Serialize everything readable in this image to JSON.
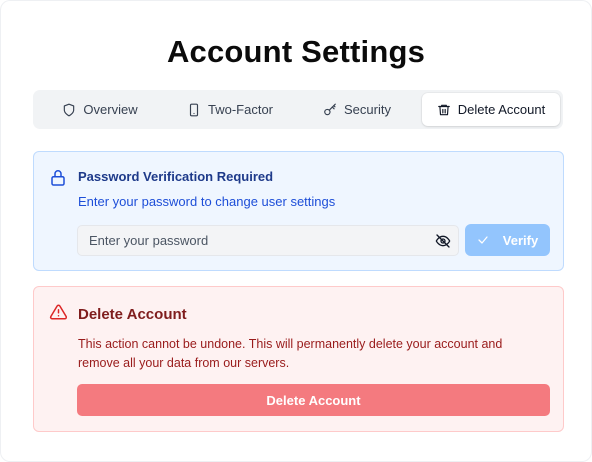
{
  "page": {
    "title": "Account Settings"
  },
  "tabs": [
    {
      "label": "Overview",
      "icon": "shield-icon",
      "active": false
    },
    {
      "label": "Two-Factor",
      "icon": "smartphone-icon",
      "active": false
    },
    {
      "label": "Security",
      "icon": "key-icon",
      "active": false
    },
    {
      "label": "Delete Account",
      "icon": "trash-icon",
      "active": true
    }
  ],
  "verification": {
    "title": "Password Verification Required",
    "description": "Enter your password to change user settings",
    "password_value": "",
    "password_placeholder": "Enter your password",
    "verify_label": "Verify",
    "icon": "lock-icon",
    "accent": "#1d4ed8"
  },
  "danger": {
    "title": "Delete Account",
    "description": "This action cannot be undone. This will permanently delete your account and remove all your data from our servers.",
    "button_label": "Delete Account",
    "icon": "alert-triangle-icon",
    "accent": "#dc2626"
  }
}
